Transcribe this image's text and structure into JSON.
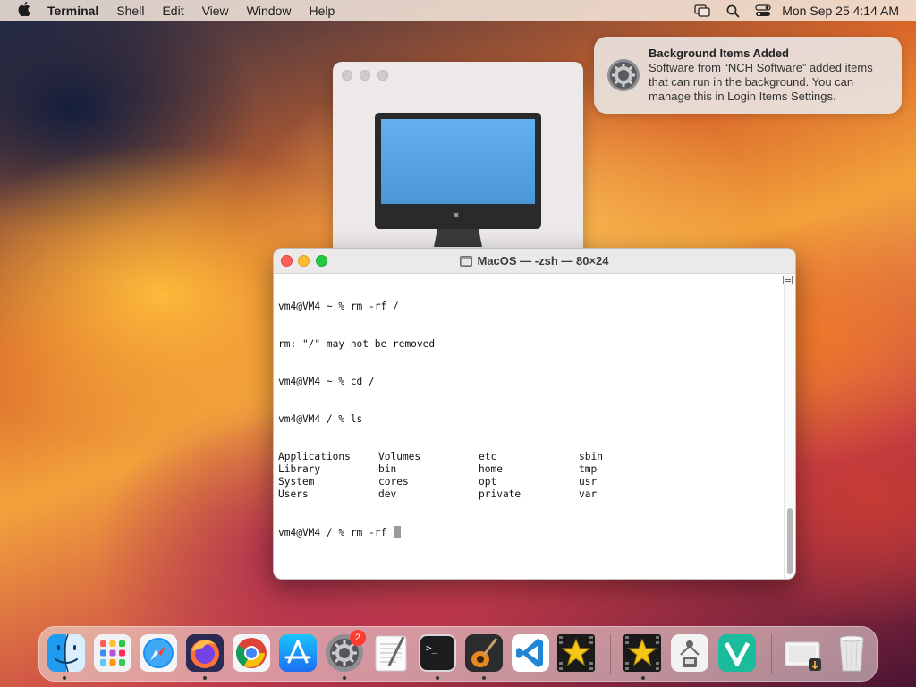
{
  "menubar": {
    "app_name": "Terminal",
    "menus": [
      "Shell",
      "Edit",
      "View",
      "Window",
      "Help"
    ],
    "clock": "Mon Sep 25  4:14 AM"
  },
  "notification": {
    "title": "Background Items Added",
    "body": "Software from “NCH Software” added items that can run in the background. You can manage this in Login Items Settings."
  },
  "terminal": {
    "title": "MacOS — -zsh — 80×24",
    "lines": [
      "vm4@VM4 ~ % rm -rf /",
      "rm: \"/\" may not be removed",
      "vm4@VM4 ~ % cd /",
      "vm4@VM4 / % ls"
    ],
    "ls_output": [
      "Applications",
      "Volumes",
      "etc",
      "sbin",
      "Library",
      "bin",
      "home",
      "tmp",
      "System",
      "cores",
      "opt",
      "usr",
      "Users",
      "dev",
      "private",
      "var"
    ],
    "current_prompt": "vm4@VM4 / % rm -rf "
  },
  "dock": {
    "items": [
      {
        "name": "finder"
      },
      {
        "name": "launchpad"
      },
      {
        "name": "safari"
      },
      {
        "name": "firefox"
      },
      {
        "name": "chrome"
      },
      {
        "name": "app-store"
      },
      {
        "name": "system-settings",
        "badge": "2"
      },
      {
        "name": "textedit"
      },
      {
        "name": "terminal"
      },
      {
        "name": "garageband"
      },
      {
        "name": "vscode"
      },
      {
        "name": "videopad"
      },
      {
        "name": "videopad-2"
      },
      {
        "name": "usb-utility"
      },
      {
        "name": "vectorworks"
      },
      {
        "name": "downloads-stack"
      },
      {
        "name": "trash"
      }
    ]
  },
  "colors": {
    "close": "#ff5f57",
    "minimize": "#febc2e",
    "maximize": "#28c840",
    "badge": "#ff3b30"
  }
}
